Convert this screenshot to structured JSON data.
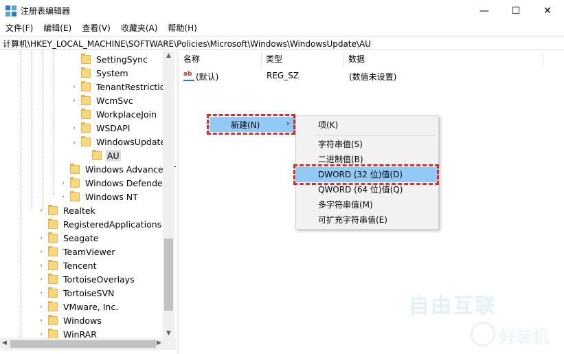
{
  "window": {
    "title": "注册表编辑器",
    "minimize": "—",
    "maximize": "☐",
    "close": "✕"
  },
  "menubar": {
    "items": [
      "文件(F)",
      "编辑(E)",
      "查看(V)",
      "收藏夹(A)",
      "帮助(H)"
    ]
  },
  "address": "计算机\\HKEY_LOCAL_MACHINE\\SOFTWARE\\Policies\\Microsoft\\Windows\\WindowsUpdate\\AU",
  "tree": {
    "items": [
      {
        "label": "SettingSync",
        "arrow": ""
      },
      {
        "label": "System",
        "arrow": ""
      },
      {
        "label": "TenantRestrictions",
        "arrow": "›"
      },
      {
        "label": "WcmSvc",
        "arrow": "›"
      },
      {
        "label": "WorkplaceJoin",
        "arrow": ""
      },
      {
        "label": "WSDAPI",
        "arrow": "›"
      },
      {
        "label": "WindowsUpdate",
        "arrow": "⌄"
      },
      {
        "label": "AU",
        "arrow": ""
      },
      {
        "label": "Windows Advanced Threat Protection",
        "arrow": ""
      },
      {
        "label": "Windows Defender",
        "arrow": "›"
      },
      {
        "label": "Windows NT",
        "arrow": "›"
      },
      {
        "label": "Realtek",
        "arrow": "›"
      },
      {
        "label": "RegisteredApplications",
        "arrow": ""
      },
      {
        "label": "Seagate",
        "arrow": "›"
      },
      {
        "label": "TeamViewer",
        "arrow": "›"
      },
      {
        "label": "Tencent",
        "arrow": "›"
      },
      {
        "label": "TortoiseOverlays",
        "arrow": "›"
      },
      {
        "label": "TortoiseSVN",
        "arrow": "›"
      },
      {
        "label": "VMware, Inc.",
        "arrow": "›"
      },
      {
        "label": "Windows",
        "arrow": "›"
      },
      {
        "label": "WinRAR",
        "arrow": "›"
      }
    ]
  },
  "values": {
    "headers": {
      "name": "名称",
      "type": "类型",
      "data": "数据"
    },
    "rows": [
      {
        "name": "(默认)",
        "type": "REG_SZ",
        "data": "(数值未设置)",
        "icon": "ab"
      }
    ]
  },
  "context_menu": {
    "new_label": "新建(N)",
    "arrow": "›"
  },
  "submenu": {
    "items": [
      "项(K)",
      "字符串值(S)",
      "二进制值(B)",
      "DWORD (32 位)值(D)",
      "QWORD (64 位)值(Q)",
      "多字符串值(M)",
      "可扩充字符串值(E)"
    ]
  },
  "watermark": {
    "top": "自由互联",
    "bottom": "好装机"
  },
  "colors": {
    "highlight": "#91c9f7",
    "annotation_red": "#d32f2f",
    "folder": "#f9d77f"
  }
}
